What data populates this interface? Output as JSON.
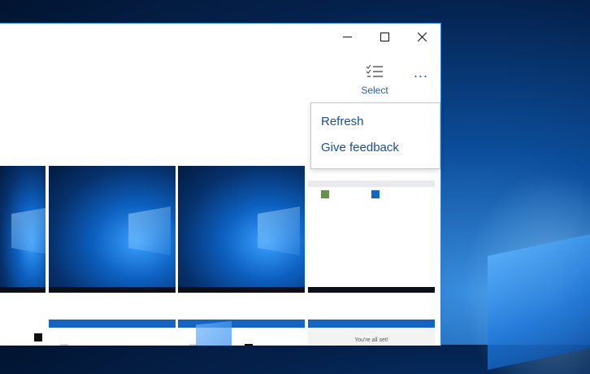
{
  "window": {
    "controls": {
      "minimize_icon": "minimize-icon",
      "maximize_icon": "maximize-icon",
      "close_icon": "close-icon"
    }
  },
  "toolbar": {
    "select_label": "Select",
    "select_icon": "checklist-icon",
    "more_label": "..."
  },
  "flyout_menu": {
    "items": [
      {
        "label": "Refresh"
      },
      {
        "label": "Give feedback"
      }
    ]
  },
  "colors": {
    "accent": "#1a5fb4",
    "window_border": "#2d7fd1",
    "desktop": "#0b4d9a"
  },
  "thumbnails": {
    "row1": [
      "wallpaper",
      "wallpaper",
      "wallpaper",
      "app-screenshot"
    ],
    "row2": [
      "app-screenshot",
      "app-screenshot",
      "app-screenshot",
      "app-screenshot"
    ],
    "onedrive_tile": {
      "title": "You're all set!"
    }
  }
}
